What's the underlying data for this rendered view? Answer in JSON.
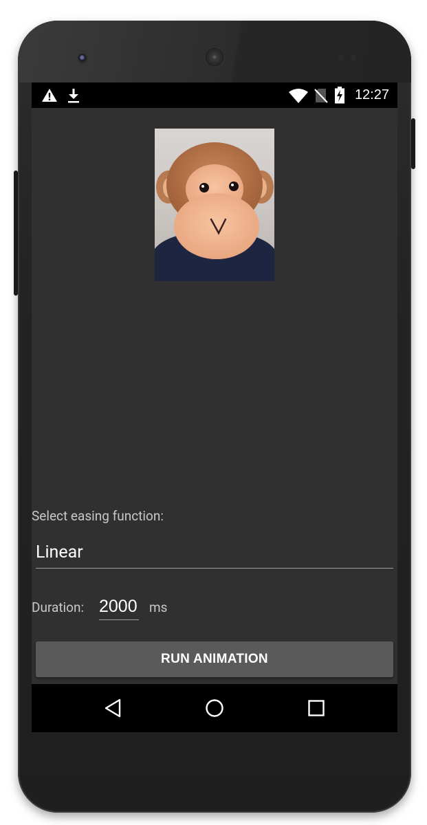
{
  "statusbar": {
    "time": "12:27",
    "icons": [
      "warning-icon",
      "download-icon",
      "wifi-icon",
      "no-sim-icon",
      "battery-charging-icon"
    ]
  },
  "main": {
    "image": "monkey-plush-photo",
    "easing_label": "Select easing function:",
    "easing_value": "Linear",
    "duration_label": "Duration:",
    "duration_value": "2000",
    "duration_unit": "ms",
    "run_button_label": "RUN ANIMATION"
  },
  "navbar": {
    "buttons": [
      "back-icon",
      "home-icon",
      "recents-icon"
    ]
  },
  "colors": {
    "screen_bg": "#303030",
    "button_bg": "#5a5a5a",
    "text": "#ffffff",
    "label": "#c8c8c8"
  }
}
